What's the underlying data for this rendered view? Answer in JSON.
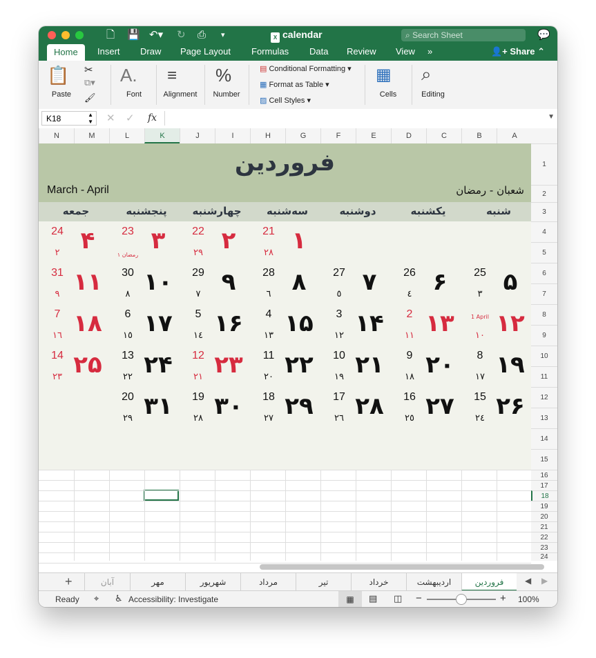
{
  "window": {
    "title": "calendar",
    "search_placeholder": "Search Sheet"
  },
  "ribbon_tabs": [
    {
      "label": "Home",
      "active": true
    },
    {
      "label": "Insert"
    },
    {
      "label": "Draw"
    },
    {
      "label": "Page Layout"
    },
    {
      "label": "Formulas"
    },
    {
      "label": "Data"
    },
    {
      "label": "Review"
    },
    {
      "label": "View"
    }
  ],
  "share_label": "Share",
  "ribbon": {
    "paste": "Paste",
    "font": "Font",
    "alignment": "Alignment",
    "number": "Number",
    "conditional_formatting": "Conditional Formatting",
    "format_as_table": "Format as Table",
    "cell_styles": "Cell Styles",
    "cells": "Cells",
    "editing": "Editing"
  },
  "formula_bar": {
    "name_box": "K18",
    "fx": "fx",
    "value": ""
  },
  "columns": [
    "N",
    "M",
    "L",
    "K",
    "J",
    "I",
    "H",
    "G",
    "F",
    "E",
    "D",
    "C",
    "B",
    "A"
  ],
  "selected_column": "K",
  "rows": [
    "1",
    "2",
    "3",
    "4",
    "5",
    "6",
    "7",
    "8",
    "9",
    "10",
    "11",
    "12",
    "13",
    "14",
    "15",
    "16",
    "17",
    "18",
    "19",
    "20",
    "21",
    "22",
    "23",
    "24"
  ],
  "selected_row": "18",
  "calendar": {
    "month_name": "فروردین",
    "gregorian_range": "March - April",
    "hijri_range": "شعبان - رمضان",
    "weekdays": [
      "شنبه",
      "یکشنبه",
      "دوشنبه",
      "سه‌شنبه",
      "چهارشنبه",
      "پنجشنبه",
      "جمعه"
    ],
    "weeks": [
      [
        null,
        null,
        null,
        {
          "persian": "۱",
          "greg": "21",
          "hijri": "۲۸",
          "holiday": true
        },
        {
          "persian": "۲",
          "greg": "22",
          "hijri": "۲۹",
          "holiday": true
        },
        {
          "persian": "۳",
          "greg": "23",
          "hijri": "",
          "note": "۱ رمضان",
          "holiday": true
        },
        {
          "persian": "۴",
          "greg": "24",
          "hijri": "۲",
          "holiday": true
        }
      ],
      [
        {
          "persian": "۵",
          "greg": "25",
          "hijri": "۳"
        },
        {
          "persian": "۶",
          "greg": "26",
          "hijri": "٤"
        },
        {
          "persian": "۷",
          "greg": "27",
          "hijri": "٥"
        },
        {
          "persian": "۸",
          "greg": "28",
          "hijri": "٦"
        },
        {
          "persian": "۹",
          "greg": "29",
          "hijri": "۷"
        },
        {
          "persian": "۱۰",
          "greg": "30",
          "hijri": "۸"
        },
        {
          "persian": "۱۱",
          "greg": "31",
          "hijri": "۹",
          "holiday": true
        }
      ],
      [
        {
          "persian": "۱۲",
          "greg": "",
          "hijri": "۱۰",
          "note_top": "1 April",
          "holiday": true
        },
        {
          "persian": "۱۳",
          "greg": "2",
          "hijri": "۱۱",
          "holiday": true
        },
        {
          "persian": "۱۴",
          "greg": "3",
          "hijri": "۱۲"
        },
        {
          "persian": "۱۵",
          "greg": "4",
          "hijri": "۱۳"
        },
        {
          "persian": "۱۶",
          "greg": "5",
          "hijri": "١٤"
        },
        {
          "persian": "۱۷",
          "greg": "6",
          "hijri": "۱٥"
        },
        {
          "persian": "۱۸",
          "greg": "7",
          "hijri": "۱٦",
          "holiday": true
        }
      ],
      [
        {
          "persian": "۱۹",
          "greg": "8",
          "hijri": "۱۷"
        },
        {
          "persian": "۲۰",
          "greg": "9",
          "hijri": "۱۸"
        },
        {
          "persian": "۲۱",
          "greg": "10",
          "hijri": "۱۹"
        },
        {
          "persian": "۲۲",
          "greg": "11",
          "hijri": "۲۰"
        },
        {
          "persian": "۲۳",
          "greg": "12",
          "hijri": "۲۱",
          "holiday": true
        },
        {
          "persian": "۲۴",
          "greg": "13",
          "hijri": "۲۲"
        },
        {
          "persian": "۲۵",
          "greg": "14",
          "hijri": "۲۳",
          "holiday": true
        }
      ],
      [
        {
          "persian": "۲۶",
          "greg": "15",
          "hijri": "۲٤"
        },
        {
          "persian": "۲۷",
          "greg": "16",
          "hijri": "۲٥"
        },
        {
          "persian": "۲۸",
          "greg": "17",
          "hijri": "۲٦"
        },
        {
          "persian": "۲۹",
          "greg": "18",
          "hijri": "۲۷"
        },
        {
          "persian": "۳۰",
          "greg": "19",
          "hijri": "۲۸"
        },
        {
          "persian": "۳۱",
          "greg": "20",
          "hijri": "۲۹"
        },
        null
      ]
    ]
  },
  "sheet_tabs": [
    "فروردین",
    "اردیبهشت",
    "خرداد",
    "تیر",
    "مرداد",
    "شهریور",
    "مهر",
    "آبان"
  ],
  "active_sheet": "فروردین",
  "status": {
    "ready": "Ready",
    "accessibility": "Accessibility: Investigate",
    "zoom": "100%"
  }
}
